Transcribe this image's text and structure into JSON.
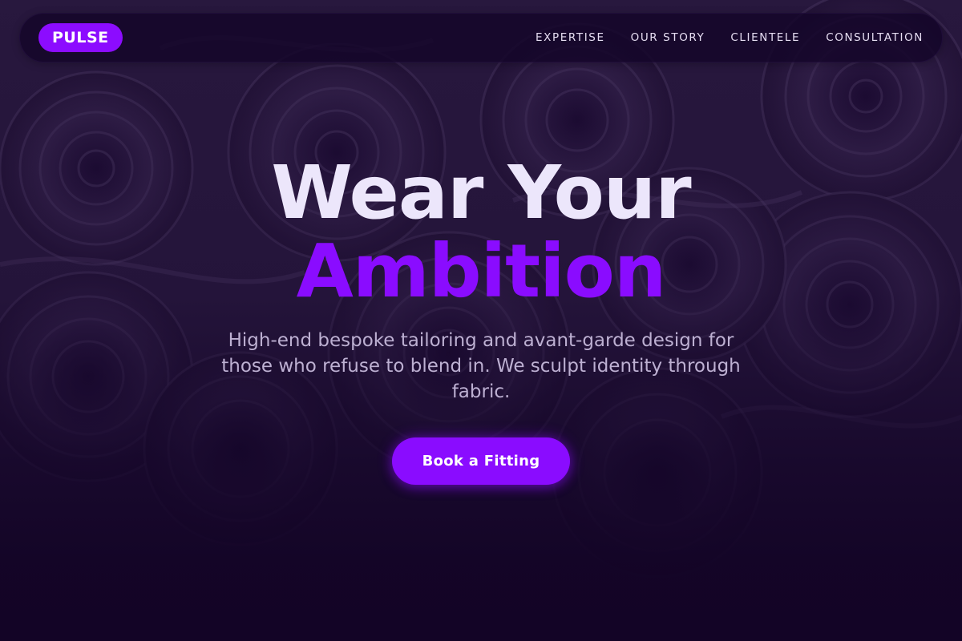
{
  "brand": {
    "logo": "PULSE",
    "accent_color": "#8a0cff"
  },
  "nav": {
    "links": [
      "EXPERTISE",
      "OUR STORY",
      "CLIENTELE",
      "CONSULTATION"
    ]
  },
  "hero": {
    "headline_line1": "Wear Your",
    "headline_line2": "Ambition",
    "subtitle": "High-end bespoke tailoring and avant-garde design for those who refuse to blend in. We sculpt identity through fabric.",
    "cta_label": "Book a Fitting",
    "background_image": "purple-fabric-rolls"
  }
}
